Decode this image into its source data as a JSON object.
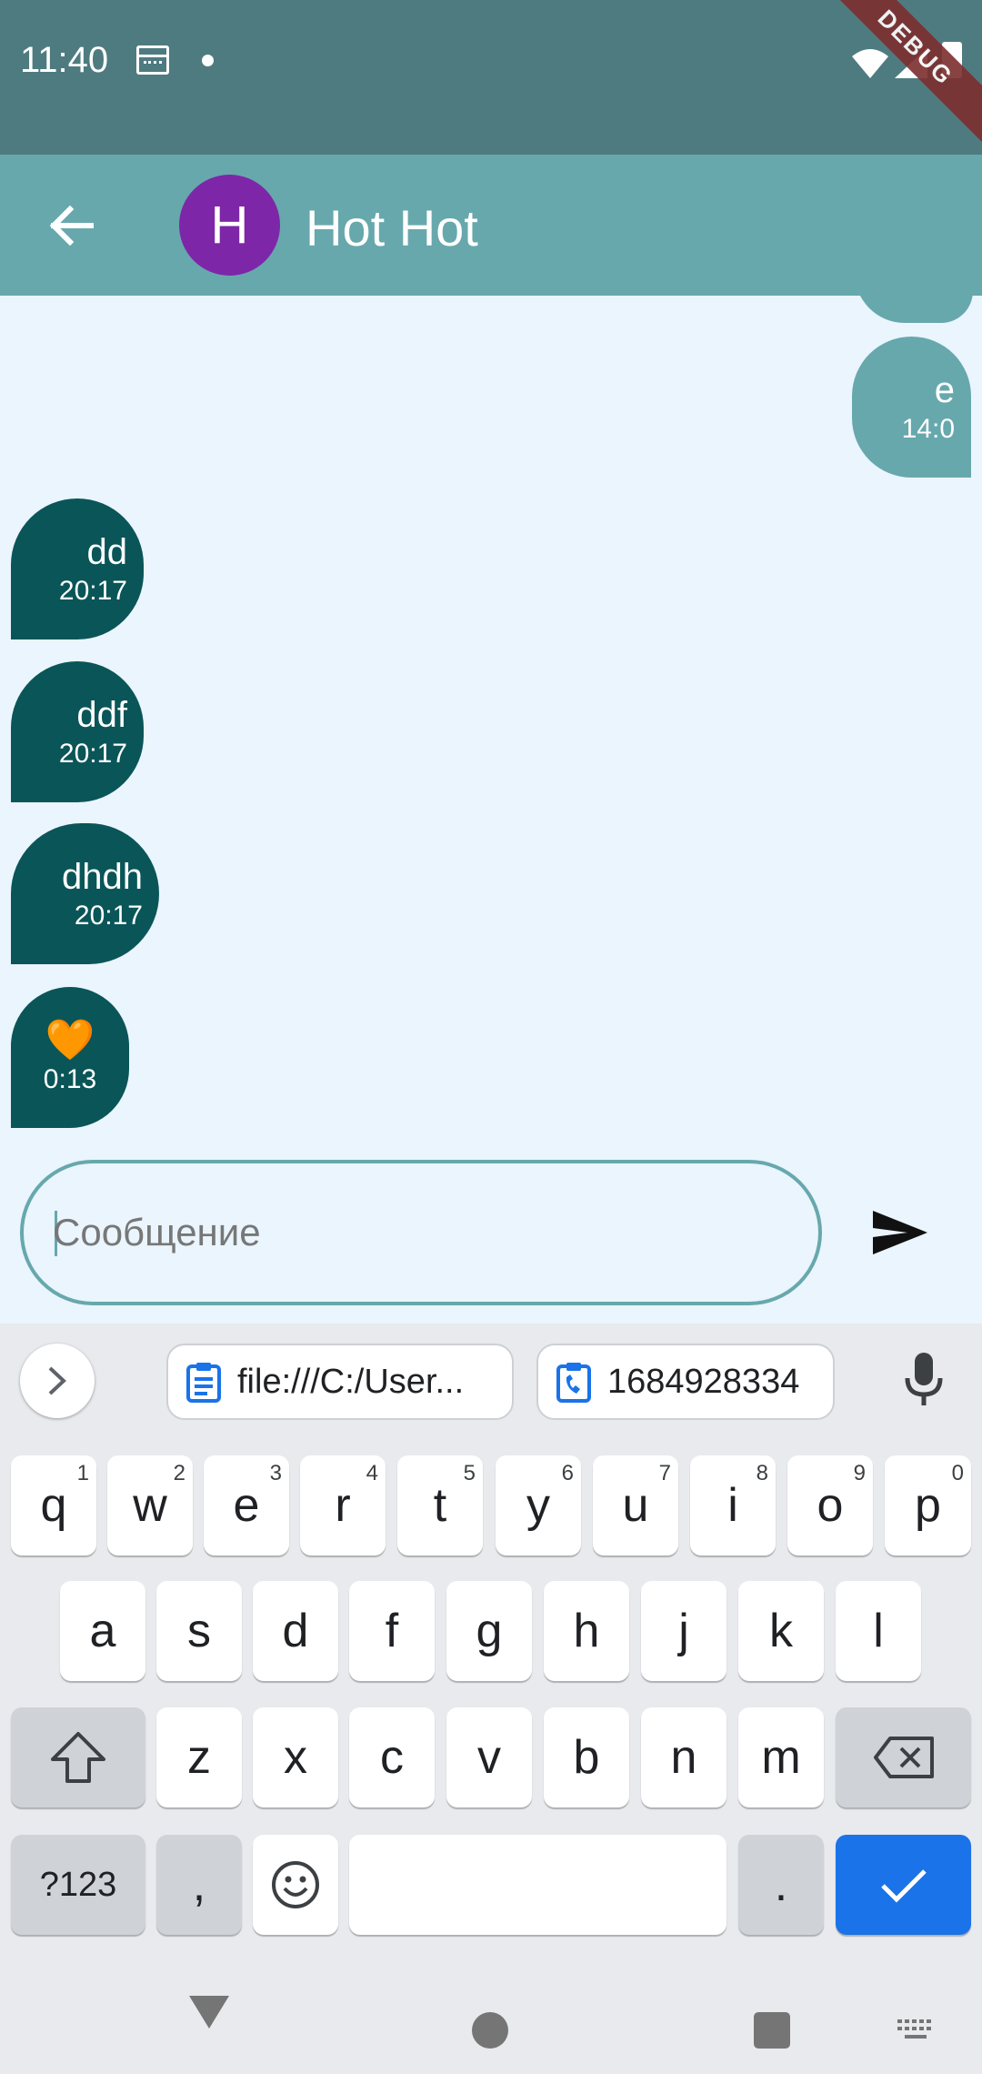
{
  "status_bar": {
    "time": "11:40",
    "debug_label": "DEBUG"
  },
  "app_bar": {
    "avatar_letter": "H",
    "title": "Hot Hot",
    "avatar_color": "#7d27a8",
    "bar_color": "#67a8ad"
  },
  "messages": [
    {
      "direction": "out",
      "text": "e",
      "time": "14:0"
    },
    {
      "direction": "in",
      "text": "dd",
      "time": "20:17"
    },
    {
      "direction": "in",
      "text": "ddf",
      "time": "20:17"
    },
    {
      "direction": "in",
      "text": "dhdh",
      "time": "20:17"
    },
    {
      "direction": "in",
      "text": "🧡",
      "time": "0:13"
    }
  ],
  "composer": {
    "placeholder": "Сообщение",
    "value": ""
  },
  "keyboard": {
    "suggestions": [
      "file:///C:/User...",
      "1684928334"
    ],
    "row1": [
      {
        "key": "q",
        "hint": "1"
      },
      {
        "key": "w",
        "hint": "2"
      },
      {
        "key": "e",
        "hint": "3"
      },
      {
        "key": "r",
        "hint": "4"
      },
      {
        "key": "t",
        "hint": "5"
      },
      {
        "key": "y",
        "hint": "6"
      },
      {
        "key": "u",
        "hint": "7"
      },
      {
        "key": "i",
        "hint": "8"
      },
      {
        "key": "o",
        "hint": "9"
      },
      {
        "key": "p",
        "hint": "0"
      }
    ],
    "row2": [
      "a",
      "s",
      "d",
      "f",
      "g",
      "h",
      "j",
      "k",
      "l"
    ],
    "row3": [
      "z",
      "x",
      "c",
      "v",
      "b",
      "n",
      "m"
    ],
    "symbols_label": "?123",
    "comma": ",",
    "period": ".",
    "accent_color": "#1a73e8"
  }
}
